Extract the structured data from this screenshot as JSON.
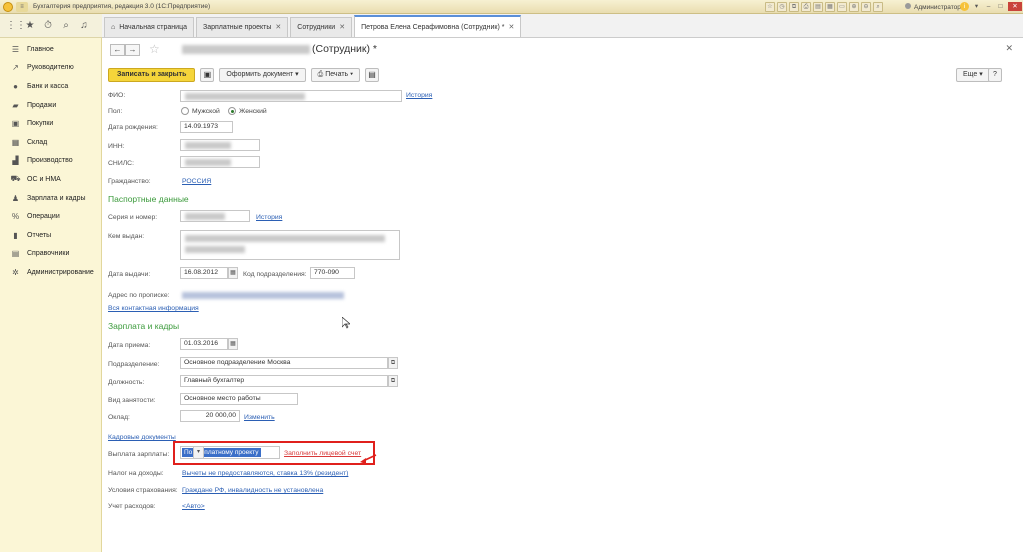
{
  "window": {
    "title": "Бухгалтерия предприятия, редакция 3.0 (1С:Предприятие)",
    "user": "Администратор"
  },
  "tabs": [
    {
      "label": "Начальная страница",
      "closable": false
    },
    {
      "label": "Зарплатные проекты",
      "closable": true
    },
    {
      "label": "Сотрудники",
      "closable": true
    },
    {
      "label": "Петрова Елена Серафимовна (Сотрудник) *",
      "closable": true,
      "active": true
    }
  ],
  "sidebar": {
    "items": [
      {
        "label": "Главное",
        "icon": "menu-icon"
      },
      {
        "label": "Руководителю",
        "icon": "trend-icon"
      },
      {
        "label": "Банк и касса",
        "icon": "bank-icon"
      },
      {
        "label": "Продажи",
        "icon": "cart-icon"
      },
      {
        "label": "Покупки",
        "icon": "basket-icon"
      },
      {
        "label": "Склад",
        "icon": "warehouse-icon"
      },
      {
        "label": "Производство",
        "icon": "factory-icon"
      },
      {
        "label": "ОС и НМА",
        "icon": "truck-icon"
      },
      {
        "label": "Зарплата и кадры",
        "icon": "people-icon"
      },
      {
        "label": "Операции",
        "icon": "operations-icon"
      },
      {
        "label": "Отчеты",
        "icon": "chart-icon"
      },
      {
        "label": "Справочники",
        "icon": "book-icon"
      },
      {
        "label": "Администрирование",
        "icon": "gear-icon"
      }
    ]
  },
  "form": {
    "title_suffix": "(Сотрудник) *",
    "toolbar": {
      "save_close": "Записать и закрыть",
      "create_doc": "Оформить документ",
      "print": "Печать",
      "more": "Еще",
      "help": "?"
    },
    "labels": {
      "fio": "ФИО:",
      "gender": "Пол:",
      "male": "Мужской",
      "female": "Женский",
      "birth_date": "Дата рождения:",
      "inn": "ИНН:",
      "snils": "СНИЛС:",
      "citizenship": "Гражданство:",
      "passport_section": "Паспортные данные",
      "series_number": "Серия и номер:",
      "issued_by": "Кем выдан:",
      "issue_date": "Дата выдачи:",
      "dept_code": "Код подразделения:",
      "address": "Адрес по прописке:",
      "contacts_link": "Вся контактная информация",
      "hr_section": "Зарплата и кадры",
      "hire_date": "Дата приема:",
      "department": "Подразделение:",
      "position": "Должность:",
      "employment_type": "Вид занятости:",
      "salary": "Оклад:",
      "hr_docs_link": "Кадровые документы",
      "payment": "Выплата зарплаты:",
      "tax": "Налог на доходы:",
      "insurance": "Условия страхования:",
      "expenses": "Учет расходов:",
      "history": "История",
      "change": "Изменить",
      "fill_account": "Заполнить лицевой счет"
    },
    "values": {
      "gender_selected": "Женский",
      "birth_date": "14.09.1973",
      "citizenship": "РОССИЯ",
      "issue_date": "16.08.2012",
      "dept_code": "770-090",
      "hire_date": "01.03.2016",
      "department": "Основное подразделение Москва",
      "position": "Главный бухгалтер",
      "employment_type": "Основное место работы",
      "salary": "20 000,00",
      "payment_method": "По зарплатному проекту",
      "tax": "Вычеты не предоставляются, ставка 13% (резидент)",
      "insurance": "Граждане РФ, инвалидность не установлена",
      "expenses": "<Авто>"
    }
  }
}
